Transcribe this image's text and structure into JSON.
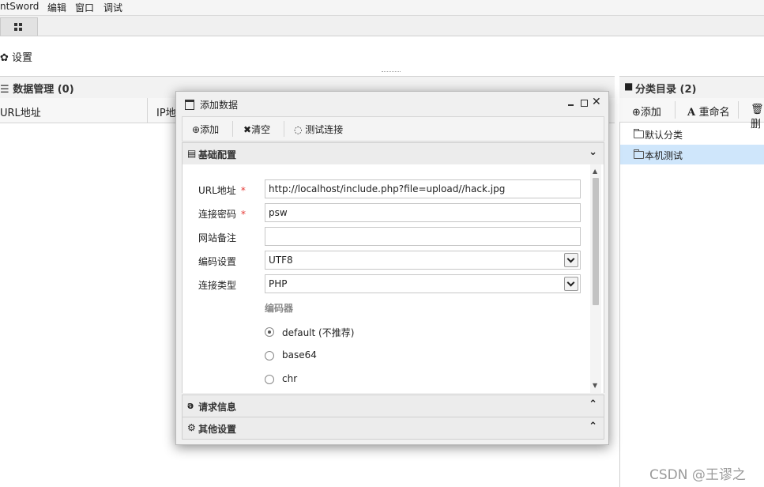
{
  "menubar": {
    "items": [
      "ntSword",
      "编辑",
      "窗口",
      "调试"
    ]
  },
  "toolbar": {
    "settings_label": "设置"
  },
  "data_panel": {
    "title": "数据管理 (0)",
    "columns": [
      "URL地址",
      "IP地"
    ]
  },
  "category_panel": {
    "title": "分类目录 (2)",
    "tools": {
      "add": "添加",
      "rename": "重命名",
      "delete": "删"
    },
    "items": [
      {
        "label": "默认分类",
        "selected": false
      },
      {
        "label": "本机测试",
        "selected": true
      }
    ]
  },
  "dialog": {
    "title": "添加数据",
    "toolbar": {
      "add": "添加",
      "clear": "清空",
      "test": "测试连接"
    },
    "sections": {
      "basic": "基础配置",
      "request": "请求信息",
      "other": "其他设置"
    },
    "form": {
      "url_label": "URL地址",
      "url_value": "http://localhost/include.php?file=upload//hack.jpg",
      "password_label": "连接密码",
      "password_value": "psw",
      "note_label": "网站备注",
      "note_value": "",
      "encoding_label": "编码设置",
      "encoding_value": "UTF8",
      "type_label": "连接类型",
      "type_value": "PHP",
      "required_mark": "*",
      "encoder_title": "编码器",
      "encoders": [
        {
          "label": "default (不推荐)",
          "checked": true
        },
        {
          "label": "base64",
          "checked": false
        },
        {
          "label": "chr",
          "checked": false
        }
      ]
    }
  },
  "watermark": "CSDN @王谬之",
  "icons": [
    "grid-icon",
    "gear-icon",
    "list-icon",
    "folder-icon",
    "window-icon",
    "plus-circle-icon",
    "close-icon",
    "spinner-icon",
    "document-icon",
    "chevron-down-icon",
    "chevron-up-icon",
    "edge-icon",
    "gears-icon",
    "font-icon",
    "trash-icon",
    "minimize-icon",
    "maximize-icon"
  ]
}
